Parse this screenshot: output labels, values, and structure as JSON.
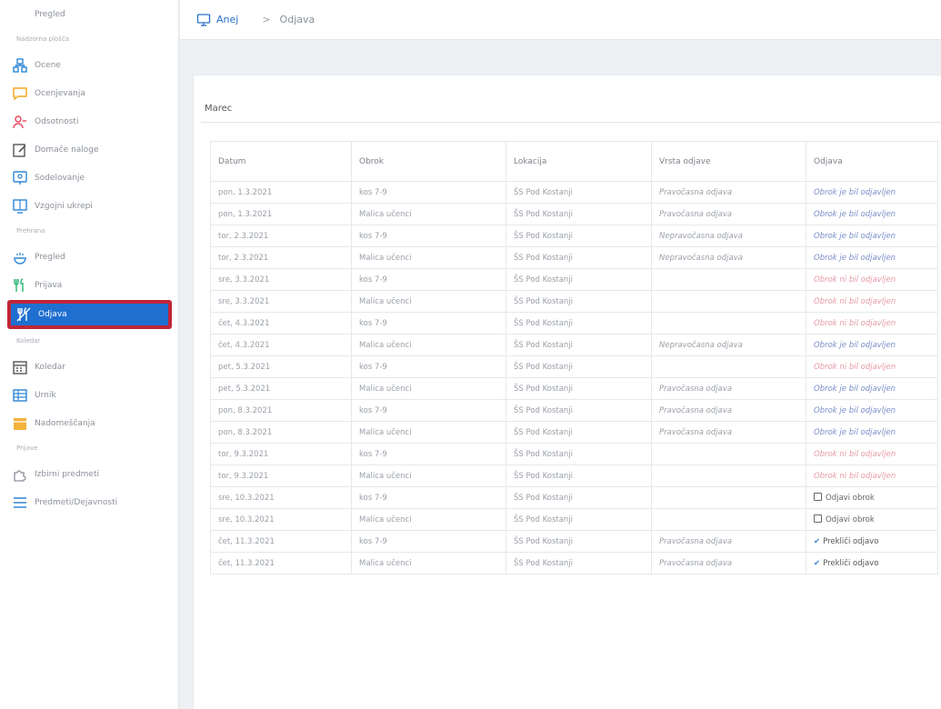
{
  "sidebar": {
    "top_item": {
      "label": "Pregled",
      "icon": "monitor-icon"
    },
    "section1": "Nadzorna plošča",
    "group1": [
      {
        "label": "Ocene",
        "icon": "hierarchy-icon",
        "color": "#2e86d6"
      },
      {
        "label": "Ocenjevanja",
        "icon": "chat-icon",
        "color": "#f2a71b"
      },
      {
        "label": "Odsotnosti",
        "icon": "user-minus-icon",
        "color": "#e8455a"
      },
      {
        "label": "Domače naloge",
        "icon": "edit-note-icon",
        "color": "#555555"
      },
      {
        "label": "Sodelovanje",
        "icon": "screen-icon",
        "color": "#2e86d6"
      },
      {
        "label": "Vzgojni ukrepi",
        "icon": "board-icon",
        "color": "#2e86d6"
      }
    ],
    "section2": "Prehrana",
    "group2": [
      {
        "label": "Pregled",
        "icon": "food-icon",
        "color": "#2e86d6"
      },
      {
        "label": "Prijava",
        "icon": "cutlery-icon",
        "color": "#2bb673"
      },
      {
        "label": "Odjava",
        "icon": "cutlery-off-icon",
        "color": "#ffffff",
        "active": true
      }
    ],
    "section3": "Koledar",
    "group3": [
      {
        "label": "Koledar",
        "icon": "calendar-icon",
        "color": "#555555"
      },
      {
        "label": "Urnik",
        "icon": "schedule-icon",
        "color": "#2e86d6"
      },
      {
        "label": "Nadomeščanja",
        "icon": "calendar-swap-icon",
        "color": "#f2a71b"
      }
    ],
    "section4": "Prijave",
    "group4": [
      {
        "label": "Izbirni predmeti",
        "icon": "puzzle-icon",
        "color": "#8a9099"
      },
      {
        "label": "Predmeti/Dejavnosti",
        "icon": "list-icon",
        "color": "#2e86d6"
      }
    ]
  },
  "breadcrumb": {
    "home": "Anej",
    "current": "Odjava"
  },
  "month": {
    "label": "Marec",
    "arrow": "◂"
  },
  "table": {
    "headers": [
      "Datum",
      "Obrok",
      "Lokacija",
      "Vrsta odjave",
      "Odjava"
    ],
    "rows": [
      [
        "pon, 1.3.2021",
        "kos 7-9",
        "ŠS Pod Kostanji",
        "Pravočasna odjava",
        "Obrok je bil odjavljen",
        "blue"
      ],
      [
        "pon, 1.3.2021",
        "Malica učenci",
        "ŠS Pod Kostanji",
        "Pravočasna odjava",
        "Obrok je bil odjavljen",
        "blue"
      ],
      [
        "tor, 2.3.2021",
        "kos 7-9",
        "ŠS Pod Kostanji",
        "Nepravočasna odjava",
        "Obrok je bil odjavljen",
        "blue"
      ],
      [
        "tor, 2.3.2021",
        "Malica učenci",
        "ŠS Pod Kostanji",
        "Nepravočasna odjava",
        "Obrok je bil odjavljen",
        "blue"
      ],
      [
        "sre, 3.3.2021",
        "kos 7-9",
        "ŠS Pod Kostanji",
        "",
        "Obrok ni bil odjavljen",
        "red"
      ],
      [
        "sre, 3.3.2021",
        "Malica učenci",
        "ŠS Pod Kostanji",
        "",
        "Obrok ni bil odjavljen",
        "red"
      ],
      [
        "čet, 4.3.2021",
        "kos 7-9",
        "ŠS Pod Kostanji",
        "",
        "Obrok ni bil odjavljen",
        "red"
      ],
      [
        "čet, 4.3.2021",
        "Malica učenci",
        "ŠS Pod Kostanji",
        "Nepravočasna odjava",
        "Obrok je bil odjavljen",
        "blue"
      ],
      [
        "pet, 5.3.2021",
        "kos 7-9",
        "ŠS Pod Kostanji",
        "",
        "Obrok ni bil odjavljen",
        "red"
      ],
      [
        "pet, 5.3.2021",
        "Malica učenci",
        "ŠS Pod Kostanji",
        "Pravočasna odjava",
        "Obrok je bil odjavljen",
        "blue"
      ],
      [
        "pon, 8.3.2021",
        "kos 7-9",
        "ŠS Pod Kostanji",
        "Pravočasna odjava",
        "Obrok je bil odjavljen",
        "blue"
      ],
      [
        "pon, 8.3.2021",
        "Malica učenci",
        "ŠS Pod Kostanji",
        "Pravočasna odjava",
        "Obrok je bil odjavljen",
        "blue"
      ],
      [
        "tor, 9.3.2021",
        "kos 7-9",
        "ŠS Pod Kostanji",
        "",
        "Obrok ni bil odjavljen",
        "red"
      ],
      [
        "tor, 9.3.2021",
        "Malica učenci",
        "ŠS Pod Kostanji",
        "",
        "Obrok ni bil odjavljen",
        "red"
      ],
      [
        "sre, 10.3.2021",
        "kos 7-9",
        "ŠS Pod Kostanji",
        "",
        "Odjavi obrok",
        "button"
      ],
      [
        "sre, 10.3.2021",
        "Malica učenci",
        "ŠS Pod Kostanji",
        "",
        "Odjavi obrok",
        "button"
      ],
      [
        "čet, 11.3.2021",
        "kos 7-9",
        "ŠS Pod Kostanji",
        "Pravočasna odjava",
        "Prekliči odjavo",
        "cancel"
      ],
      [
        "čet, 11.3.2021",
        "Malica učenci",
        "ŠS Pod Kostanji",
        "Pravočasna odjava",
        "Prekliči odjavo",
        "cancel"
      ]
    ]
  }
}
